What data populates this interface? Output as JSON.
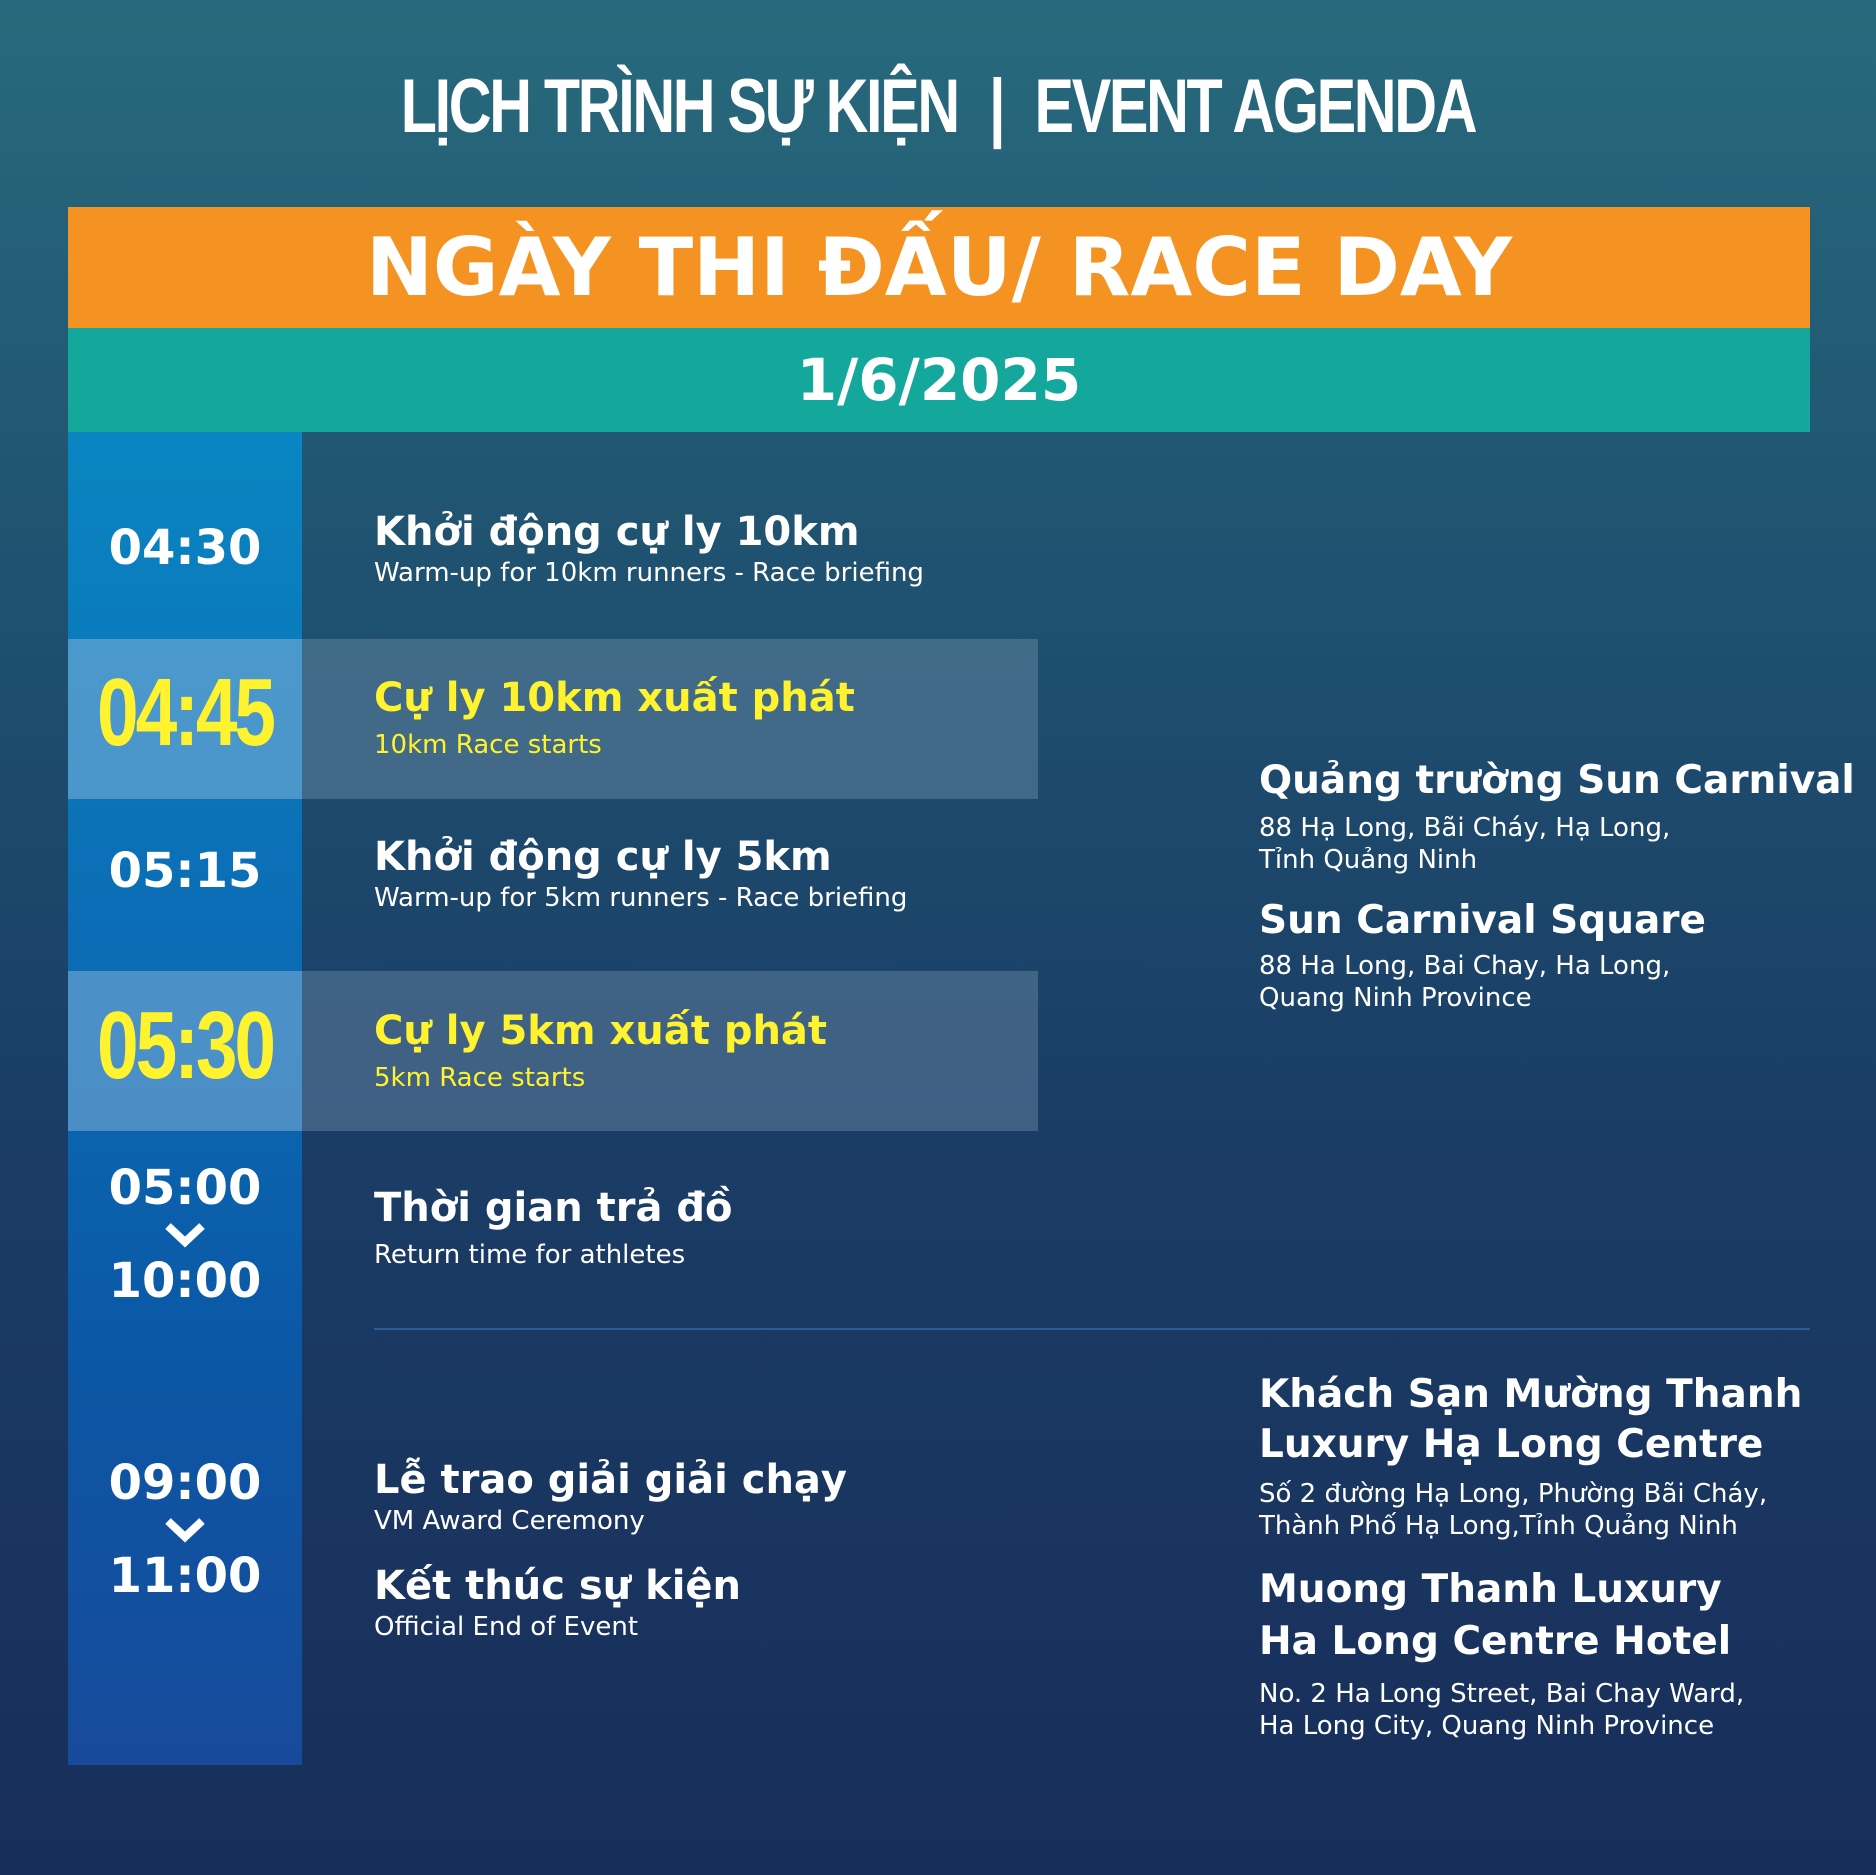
{
  "header": {
    "title_vi": "LỊCH TRÌNH SỰ KIỆN",
    "separator": "|",
    "title_en": "EVENT AGENDA"
  },
  "race_day": {
    "label": "NGÀY THI ĐẤU/ RACE DAY",
    "date": "1/6/2025"
  },
  "schedule": [
    {
      "time": "04:30",
      "title_vi": "Khởi động cự ly 10km",
      "title_en": "Warm-up for 10km runners - Race briefing",
      "highlight": false
    },
    {
      "time": "04:45",
      "title_vi": "Cự ly 10km xuất phát",
      "title_en": "10km Race starts",
      "highlight": true
    },
    {
      "time": "05:15",
      "title_vi": "Khởi động cự ly 5km",
      "title_en": "Warm-up for 5km runners - Race briefing",
      "highlight": false
    },
    {
      "time": "05:30",
      "title_vi": "Cự ly 5km xuất phát",
      "title_en": "5km Race starts",
      "highlight": true
    },
    {
      "time_start": "05:00",
      "time_end": "10:00",
      "title_vi": "Thời gian trả đồ",
      "title_en": "Return time for athletes",
      "highlight": false
    },
    {
      "time_start": "09:00",
      "time_end": "11:00",
      "items": [
        {
          "title_vi": "Lễ trao giải giải chạy",
          "title_en": "VM Award Ceremony"
        },
        {
          "title_vi": "Kết thúc sự kiện",
          "title_en": "Official End of Event"
        }
      ],
      "highlight": false
    }
  ],
  "venues": [
    {
      "name_vi": "Quảng trường Sun Carnival",
      "addr_vi": [
        "88 Hạ Long, Bãi Cháy, Hạ Long,",
        "Tỉnh Quảng Ninh"
      ],
      "name_en": "Sun Carnival Square",
      "addr_en": [
        "88 Ha Long, Bai Chay, Ha Long,",
        "Quang Ninh Province"
      ]
    },
    {
      "name_vi": [
        "Khách Sạn Mường Thanh",
        "Luxury Hạ Long Centre"
      ],
      "addr_vi": [
        "Số 2 đường Hạ Long, Phường Bãi Cháy,",
        "Thành Phố Hạ Long,Tỉnh Quảng Ninh"
      ],
      "name_en": [
        "Muong Thanh Luxury",
        "Ha Long Centre Hotel"
      ],
      "addr_en": [
        "No. 2 Ha Long Street, Bai Chay Ward,",
        "Ha Long City, Quang Ninh Province"
      ]
    }
  ],
  "colors": {
    "orange": "#f59322",
    "teal": "#14a79c",
    "highlight_text": "#fff22f",
    "time_column": "#0b6bb4"
  }
}
